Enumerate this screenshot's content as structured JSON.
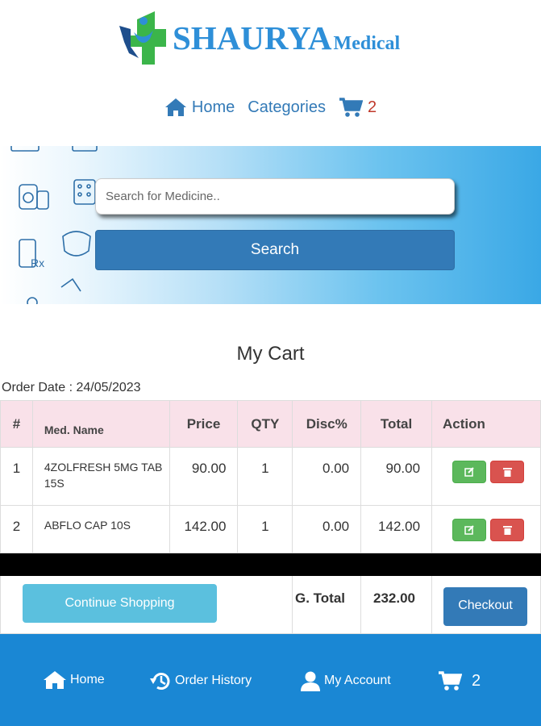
{
  "brand": {
    "name": "SHAURYA",
    "suffix": "Medical"
  },
  "topnav": {
    "home": "Home",
    "categories": "Categories",
    "cart_count": "2"
  },
  "search": {
    "placeholder": "Search for Medicine..",
    "button": "Search"
  },
  "cart": {
    "title": "My Cart",
    "order_date": "Order Date : 24/05/2023",
    "headers": [
      "#",
      "Med. Name",
      "Price",
      "QTY",
      "Disc%",
      "Total",
      "Action"
    ],
    "rows": [
      {
        "idx": "1",
        "name": "4ZOLFRESH 5MG TAB 15S",
        "price": "90.00",
        "qty": "1",
        "disc": "0.00",
        "total": "90.00"
      },
      {
        "idx": "2",
        "name": "ABFLO CAP 10S",
        "price": "142.00",
        "qty": "1",
        "disc": "0.00",
        "total": "142.00"
      }
    ],
    "continue_label": "Continue Shopping",
    "gtotal_label": "G. Total",
    "gtotal_value": "232.00",
    "checkout_label": "Checkout"
  },
  "bottomnav": {
    "home": "Home",
    "history": "Order History",
    "account": "My Account",
    "cart_count": "2"
  },
  "colors": {
    "brand": "#2e8fd8",
    "primary": "#337ab7",
    "bottom_bar": "#1a87d4",
    "header_row": "#f9e1e9"
  }
}
